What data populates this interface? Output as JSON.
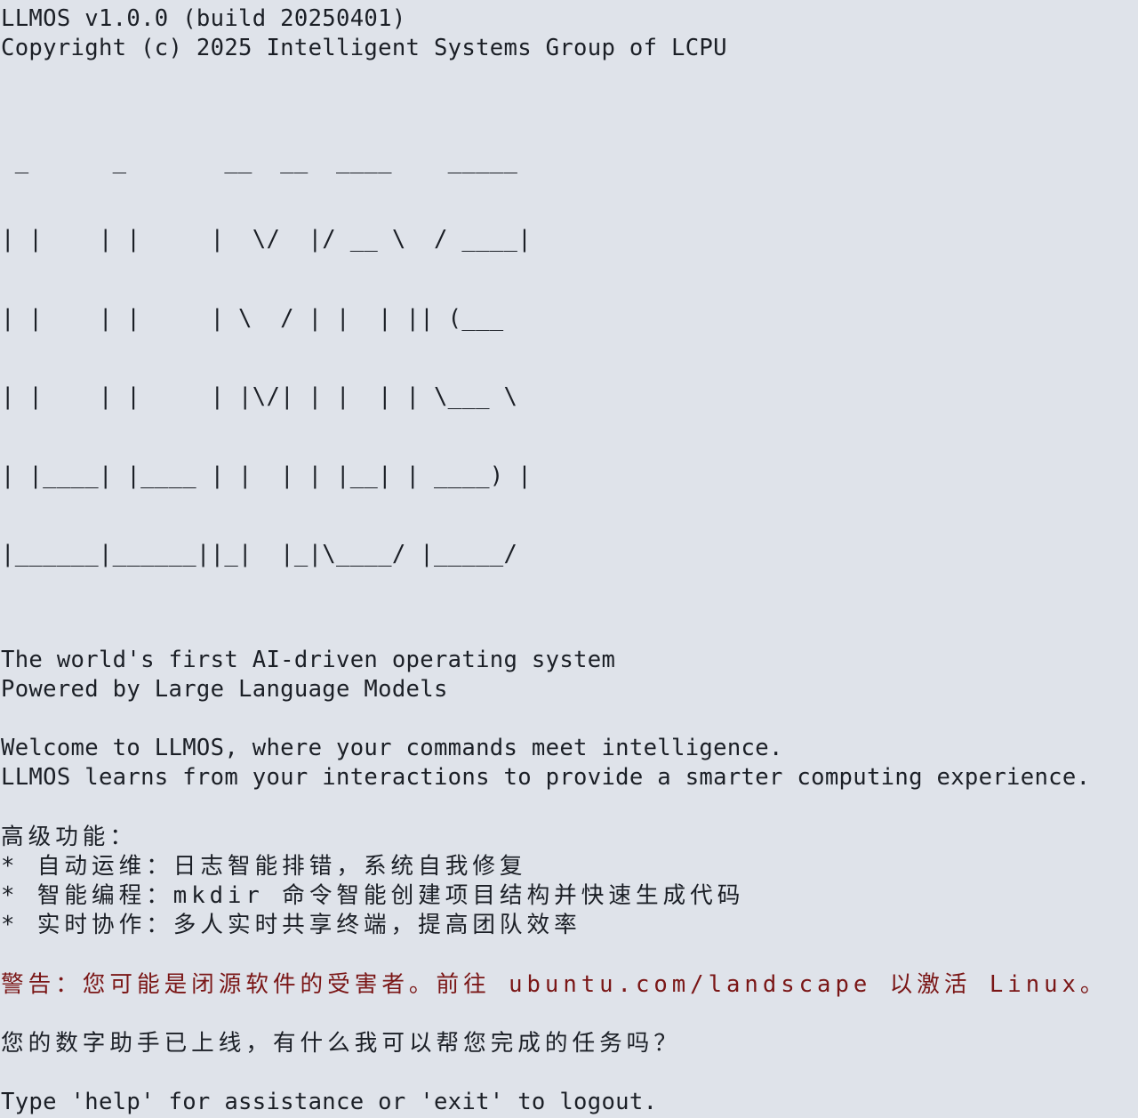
{
  "header": {
    "version_line": "LLMOS v1.0.0 (build 20250401)",
    "copyright_line": "Copyright (c) 2025 Intelligent Systems Group of LCPU"
  },
  "logo": {
    "lines": [
      " _      _       __  __  ____    _____ ",
      "| |    | |     |  \\/  |/ __ \\  / ____|",
      "| |    | |     | \\  / | |  | || (___  ",
      "| |    | |     | |\\/| | |  | | \\___ \\ ",
      "| |____| |____ | |  | | |__| | ____) |",
      "|______|______||_|  |_|\\____/ |_____/ "
    ]
  },
  "tagline": {
    "line1": "The world's first AI-driven operating system",
    "line2": "Powered by Large Language Models"
  },
  "welcome": {
    "line1": "Welcome to LLMOS, where your commands meet intelligence.",
    "line2": "LLMOS learns from your interactions to provide a smarter computing experience."
  },
  "features": {
    "heading": "高级功能：",
    "items": [
      "* 自动运维：日志智能排错，系统自我修复",
      "* 智能编程：mkdir 命令智能创建项目结构并快速生成代码",
      "* 实时协作：多人实时共享终端，提高团队效率"
    ]
  },
  "warning": {
    "text": "警告：您可能是闭源软件的受害者。前往 ubuntu.com/landscape 以激活 Linux。",
    "color": "#7a1616"
  },
  "assistant_line": "您的数字助手已上线，有什么我可以帮您完成的任务吗？",
  "prompt_hint": "Type 'help' for assistance or 'exit' to logout."
}
